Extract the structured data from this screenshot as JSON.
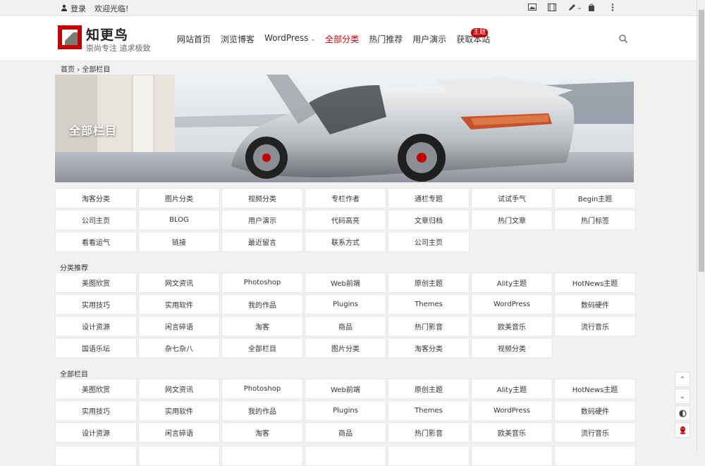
{
  "topbar": {
    "login_label": "登录",
    "welcome": "欢迎光临!",
    "tools": [
      "image-icon",
      "video-icon",
      "edit-icon",
      "bag-icon",
      "more-icon"
    ]
  },
  "header": {
    "site_name": "知更鸟",
    "slogan": "崇尚专注 追求极致",
    "nav": [
      "网站首页",
      "浏览博客",
      "WordPress",
      "全部分类",
      "热门推荐",
      "用户演示",
      "获取本站"
    ],
    "badge": "主题",
    "accent_color": "#c40000"
  },
  "breadcrumb": {
    "home": "首页",
    "separator": "›",
    "current": "全部栏目"
  },
  "banner": {
    "title": "全部栏目"
  },
  "grid_top": [
    "淘客分类",
    "图片分类",
    "视频分类",
    "专栏作者",
    "通栏专题",
    "试试手气",
    "Begin主题",
    "公司主页",
    "BLOG",
    "用户演示",
    "代码高亮",
    "文章归档",
    "热门文章",
    "热门标签",
    "看看运气",
    "链接",
    "最近留言",
    "联系方式",
    "公司主页"
  ],
  "section_recommend": {
    "title": "分类推荐",
    "items": [
      "美图欣赏",
      "网文资讯",
      "Photoshop",
      "Web前端",
      "原创主题",
      "Ality主题",
      "HotNews主题",
      "实用技巧",
      "实用软件",
      "我的作品",
      "Plugins",
      "Themes",
      "WordPress",
      "数码硬件",
      "设计资源",
      "闲言碎语",
      "淘客",
      "商品",
      "热门影音",
      "欧美音乐",
      "流行音乐",
      "国语乐坛",
      "杂七杂八",
      "全部栏目",
      "图片分类",
      "淘客分类",
      "视频分类"
    ]
  },
  "section_all": {
    "title": "全部栏目",
    "items": [
      "美图欣赏",
      "网文资讯",
      "Photoshop",
      "Web前端",
      "原创主题",
      "Ality主题",
      "HotNews主题",
      "实用技巧",
      "实用软件",
      "我的作品",
      "Plugins",
      "Themes",
      "WordPress",
      "数码硬件",
      "设计资源",
      "闲言碎语",
      "淘客",
      "商品",
      "热门影音",
      "欧美音乐",
      "流行音乐"
    ]
  },
  "float_tools": [
    "scroll-up-icon",
    "scroll-down-icon",
    "contrast-icon",
    "qq-icon"
  ]
}
